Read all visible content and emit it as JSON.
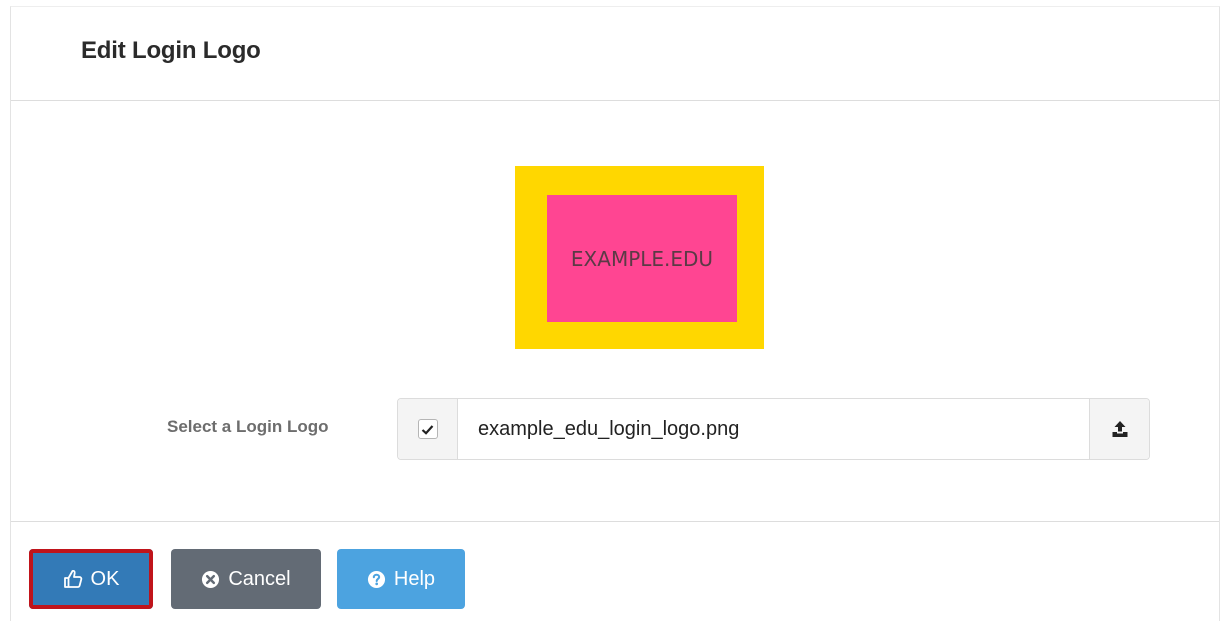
{
  "dialog": {
    "title": "Edit Login Logo"
  },
  "logo_preview": {
    "text": "EXAMPLE.EDU",
    "outer_color": "#ffd700",
    "inner_color": "#ff4592"
  },
  "file_field": {
    "label": "Select a Login Logo",
    "checked": true,
    "file_name": "example_edu_login_logo.png",
    "upload_icon": "upload-icon"
  },
  "footer": {
    "ok_label": "OK",
    "cancel_label": "Cancel",
    "help_label": "Help",
    "ok_icon": "thumbs-up-icon",
    "cancel_icon": "times-circle-icon",
    "help_icon": "question-circle-icon"
  }
}
